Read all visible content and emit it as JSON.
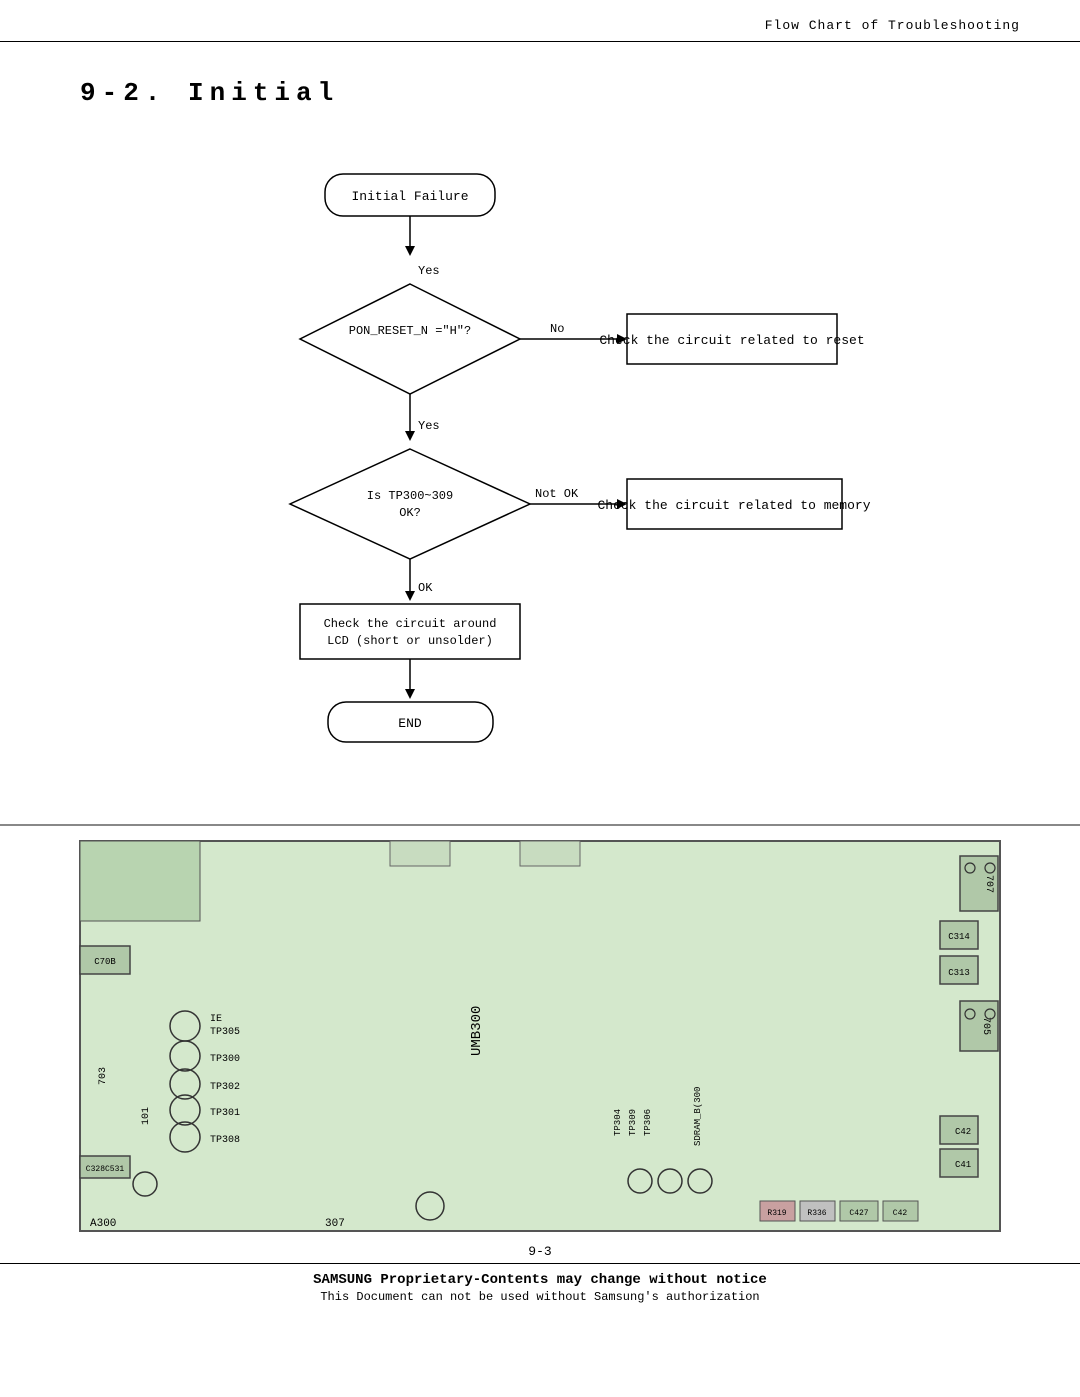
{
  "header": {
    "title": "Flow Chart of Troubleshooting"
  },
  "section": {
    "title": "9-2.  Initial"
  },
  "flowchart": {
    "nodes": {
      "initial_failure": "Initial Failure",
      "pon_reset": "PON_RESET_N =\"H\"?",
      "check_reset": "Check the circuit related to reset",
      "tp300_check": "Is TP300~309\nOK?",
      "check_memory": "Check the circuit related to memory",
      "check_lcd": "Check the circuit around\nLCD (short or unsolder)",
      "end": "END"
    },
    "labels": {
      "yes1": "Yes",
      "no1": "No",
      "yes2": "Yes",
      "not_ok": "Not OK",
      "ok": "OK"
    }
  },
  "page_number": "9-3",
  "footer": {
    "main": "SAMSUNG Proprietary-Contents may change without notice",
    "sub": "This Document can not be used without Samsung's authorization"
  }
}
